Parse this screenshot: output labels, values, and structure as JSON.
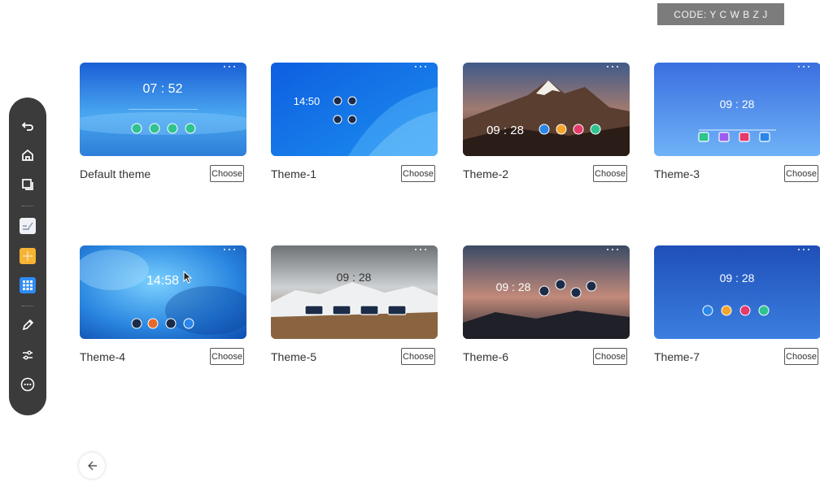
{
  "code_badge": "CODE: Y C W B Z J",
  "sidebar": {
    "items": [
      {
        "name": "back-icon"
      },
      {
        "name": "home-icon"
      },
      {
        "name": "windows-icon"
      },
      {
        "name": "whiteboard-icon"
      },
      {
        "name": "notes-icon"
      },
      {
        "name": "apps-icon"
      },
      {
        "name": "pen-icon"
      },
      {
        "name": "settings-icon"
      },
      {
        "name": "more-icon"
      }
    ]
  },
  "themes": [
    {
      "label": "Default theme",
      "choose": "Choose",
      "time": "07 : 52"
    },
    {
      "label": "Theme-1",
      "choose": "Choose",
      "time": "14:50"
    },
    {
      "label": "Theme-2",
      "choose": "Choose",
      "time": "09 : 28"
    },
    {
      "label": "Theme-3",
      "choose": "Choose",
      "time": "09 : 28"
    },
    {
      "label": "Theme-4",
      "choose": "Choose",
      "time": "14:58"
    },
    {
      "label": "Theme-5",
      "choose": "Choose",
      "time": "09 : 28"
    },
    {
      "label": "Theme-6",
      "choose": "Choose",
      "time": "09 : 28"
    },
    {
      "label": "Theme-7",
      "choose": "Choose",
      "time": "09 : 28"
    }
  ],
  "back_button": {
    "icon": "arrow-left-icon"
  }
}
